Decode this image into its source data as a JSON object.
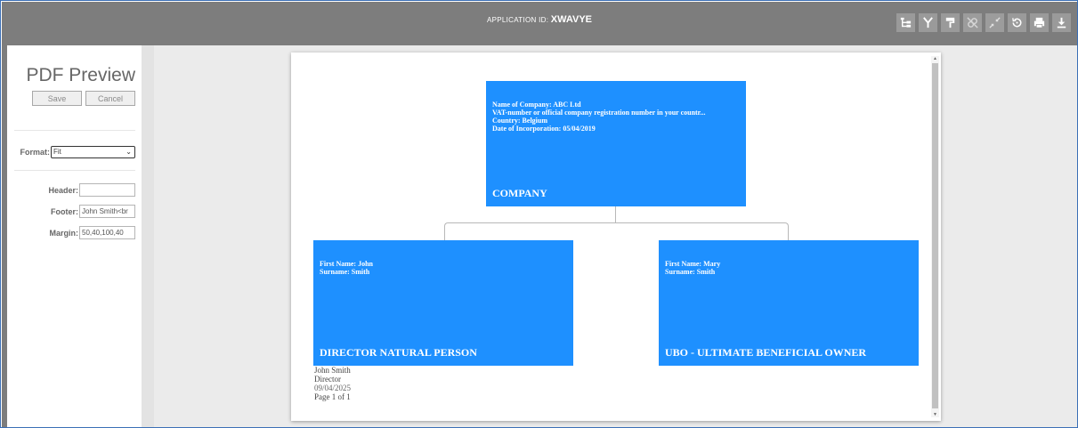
{
  "header": {
    "app_id_label": "APPLICATION ID:",
    "app_id_value": "XWAVYE",
    "toolbar": [
      {
        "name": "hierarchy-icon"
      },
      {
        "name": "branch-icon"
      },
      {
        "name": "paint-roller-icon"
      },
      {
        "name": "unlink-icon"
      },
      {
        "name": "collapse-icon"
      },
      {
        "name": "reset-icon"
      },
      {
        "name": "print-icon"
      },
      {
        "name": "download-icon"
      }
    ]
  },
  "panel": {
    "title": "PDF Preview",
    "save_label": "Save",
    "cancel_label": "Cancel",
    "format_label": "Format:",
    "format_value": "Fit",
    "header_label": "Header:",
    "header_value": "",
    "footer_label": "Footer:",
    "footer_value": "John Smith<br",
    "margin_label": "Margin:",
    "margin_value": "50,40,100,40"
  },
  "chart": {
    "company": {
      "lines": [
        "Name of Company: ABC Ltd",
        "VAT-number or official company registration number in your countr...",
        "Country: Belgium",
        "Date of Incorporation: 05/04/2019"
      ],
      "role": "COMPANY"
    },
    "director": {
      "lines": [
        "First Name: John",
        "Surname: Smith"
      ],
      "role": "DIRECTOR NATURAL PERSON"
    },
    "ubo": {
      "lines": [
        "First Name: Mary",
        "Surname: Smith"
      ],
      "role": "UBO - ULTIMATE BENEFICIAL OWNER"
    }
  },
  "footer": {
    "name": "John Smith",
    "title": "Director",
    "date": "09/04/2025",
    "page": "Page 1 of 1"
  },
  "colors": {
    "topbar": "#7d7d7d",
    "node": "#1e90ff"
  }
}
